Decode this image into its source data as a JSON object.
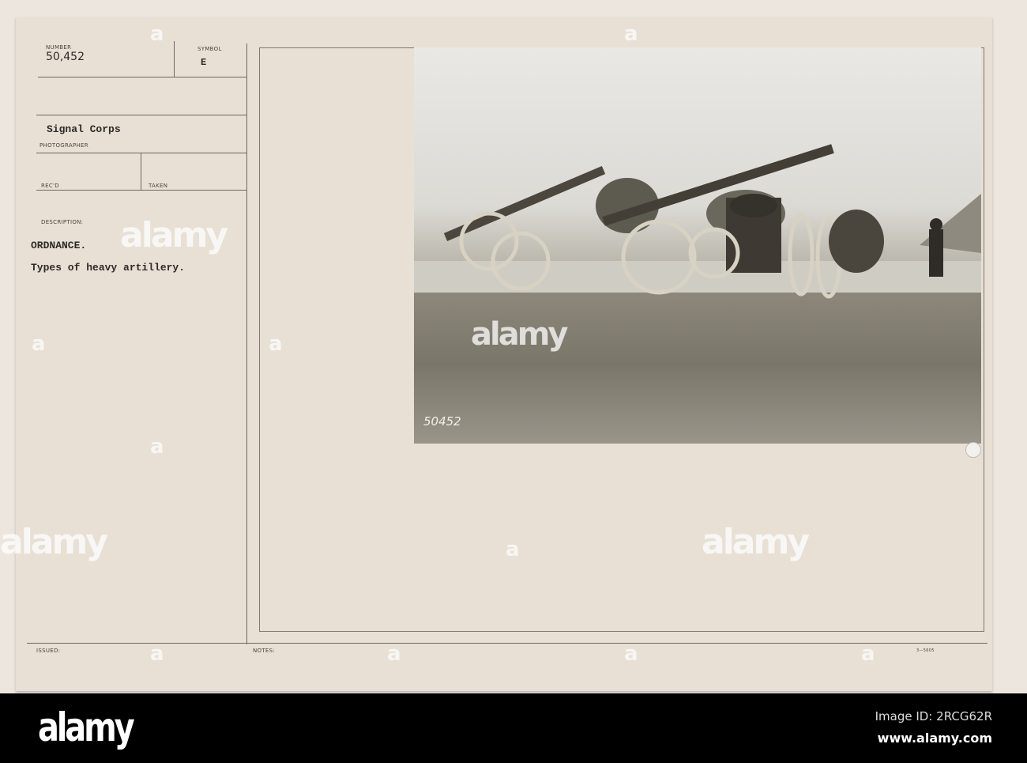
{
  "card": {
    "number_label": "NUMBER",
    "number": "50,452",
    "symbol_label": "SYMBOL",
    "symbol": "E",
    "photographer": "Signal Corps",
    "photographer_label": "PHOTOGRAPHER",
    "recd_label": "REC'D",
    "taken_label": "TAKEN",
    "description_label": "DESCRIPTION:",
    "description_title": "ORDNANCE.",
    "description_text": "Types of heavy artillery.",
    "issued_label": "ISSUED:",
    "notes_label": "NOTES:",
    "form_number": "3—5605"
  },
  "photo": {
    "negative_number": "50452"
  },
  "watermark": {
    "text": "alamy",
    "letter": "a"
  },
  "footer": {
    "logo": "alamy",
    "image_id": "Image ID: 2RCG62R",
    "url": "www.alamy.com"
  }
}
